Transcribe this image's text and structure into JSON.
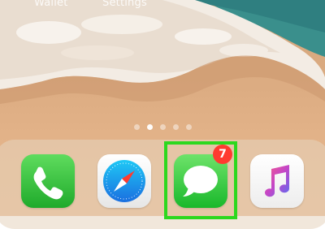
{
  "top_bar": {
    "wallet_label": "Wallet",
    "settings_label": "Settings"
  },
  "page_indicator": {
    "count": 5,
    "active_index": 1
  },
  "dock": {
    "apps": [
      {
        "name": "Phone",
        "icon": "phone-icon",
        "color": "#2fbf3a"
      },
      {
        "name": "Safari",
        "icon": "safari-compass-icon",
        "color": "#2c8df5"
      },
      {
        "name": "Messages",
        "icon": "speech-bubble-icon",
        "color": "#25c23a",
        "badge": "7",
        "highlighted": true
      },
      {
        "name": "Music",
        "icon": "music-note-icon",
        "color": "#f5336f"
      }
    ]
  },
  "colors": {
    "badge": "#ff3b30",
    "highlight": "#2cd81e",
    "sand": "#e4b48a",
    "ocean": "#2f8c8e"
  }
}
